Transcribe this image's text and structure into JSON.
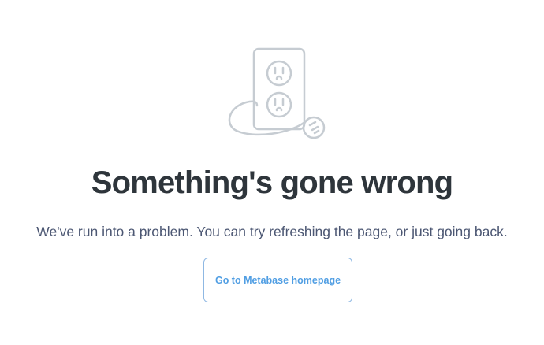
{
  "error": {
    "title": "Something's gone wrong",
    "message": "We've run into a problem. You can try refreshing the page, or just going back.",
    "home_button_label": "Go to Metabase homepage",
    "illustration_icon": "unplugged-outlet-icon"
  },
  "colors": {
    "title": "#2e353b",
    "message": "#4c5773",
    "accent": "#509ee3",
    "illustration_stroke": "#c6ccd2"
  }
}
